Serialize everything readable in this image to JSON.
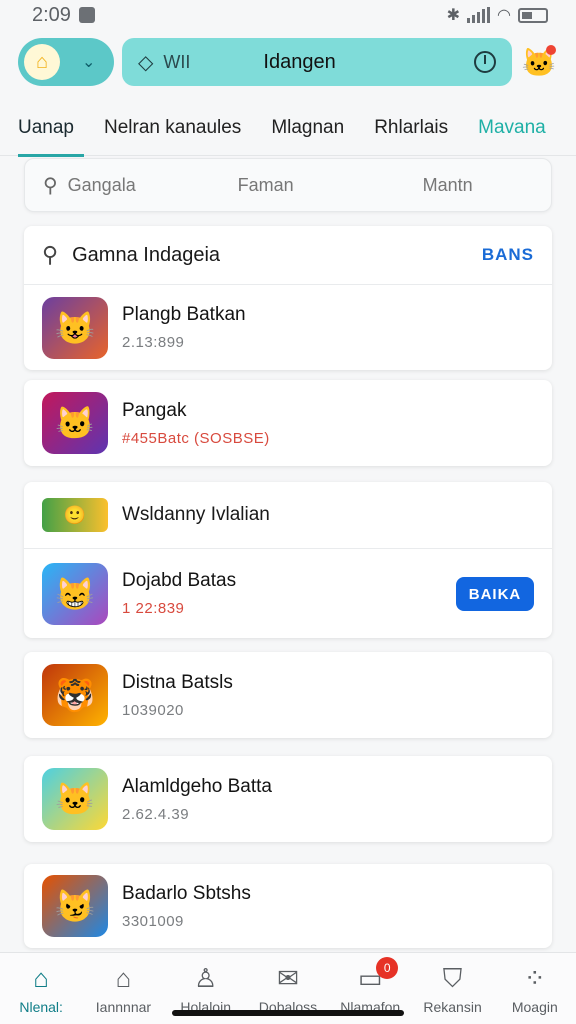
{
  "status_bar": {
    "time": "2:09"
  },
  "header": {
    "search_placeholder": "WII",
    "title": "Idangen"
  },
  "tabs": [
    {
      "label": "Uanap"
    },
    {
      "label": "Nelran kanaules"
    },
    {
      "label": "Mlagnan"
    },
    {
      "label": "Rhlarlais"
    },
    {
      "label": "Mavana"
    }
  ],
  "filter": {
    "items": [
      "Gangala",
      "Faman",
      "Mantn"
    ]
  },
  "section1": {
    "title": "Gamna Indageia",
    "action": "BANS",
    "items": [
      {
        "name": "Plangb Batkan",
        "sub": "2.13:899"
      },
      {
        "name": "Pangak",
        "sub": "#455Batc (SOSBSE)"
      }
    ]
  },
  "section2": {
    "title": "Wsldanny Ivlalian",
    "items": [
      {
        "name": "Dojabd Batas",
        "sub": "1 22:839",
        "button": "BAIKA"
      }
    ]
  },
  "list": [
    {
      "name": "Distna Batsls",
      "sub": "1039020"
    },
    {
      "name": "Alamldgeho Batta",
      "sub": "2.62.4.39"
    },
    {
      "name": "Badarlo Sbtshs",
      "sub": "3301009"
    }
  ],
  "bottom_nav": [
    {
      "label": "Nlenal:",
      "icon": "home-icon"
    },
    {
      "label": "Iannnnar",
      "icon": "house-outline-icon"
    },
    {
      "label": "Holaloin",
      "icon": "person-icon"
    },
    {
      "label": "Dobaloss",
      "icon": "mail-icon"
    },
    {
      "label": "Nlamafon",
      "icon": "chat-icon",
      "badge": "0"
    },
    {
      "label": "Rekansin",
      "icon": "shield-icon"
    },
    {
      "label": "Moagin",
      "icon": "dots-icon"
    }
  ],
  "colors": {
    "accent": "#28a6a6",
    "button": "#1266e0",
    "badge": "#e63226"
  }
}
